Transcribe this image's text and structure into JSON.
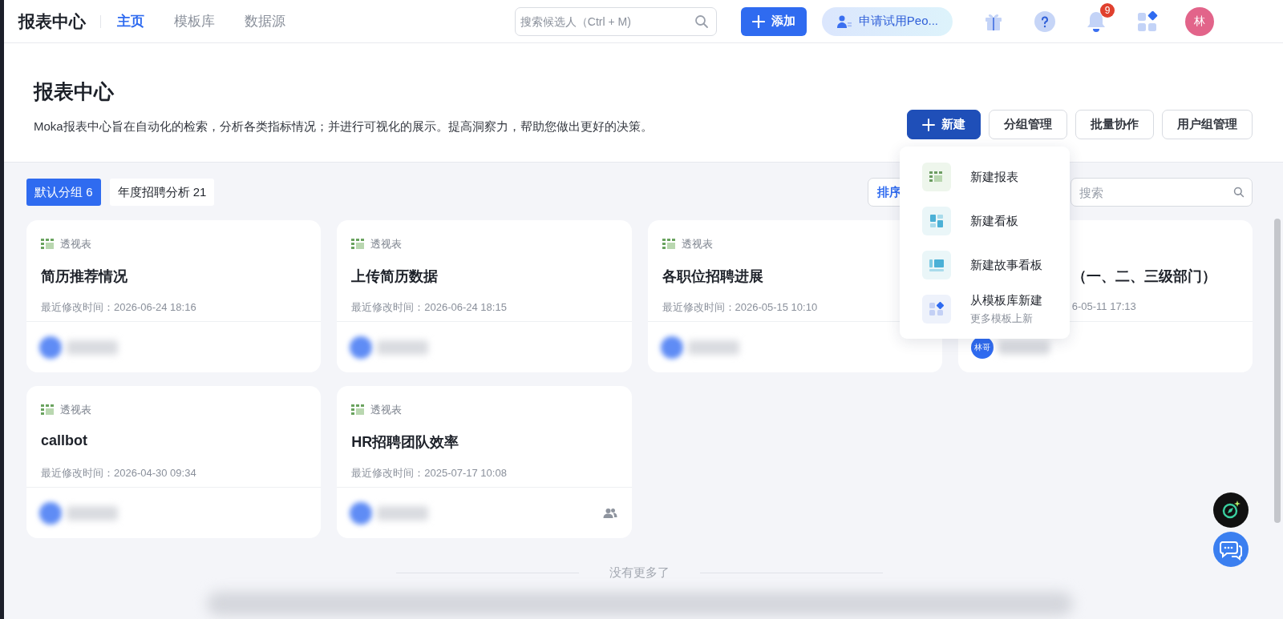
{
  "nav": {
    "logo": "报表中心",
    "tabs": [
      {
        "label": "主页",
        "selected": true
      },
      {
        "label": "模板库",
        "selected": false
      },
      {
        "label": "数据源",
        "selected": false
      }
    ],
    "search": {
      "placeholder": "搜索候选人（Ctrl + M)"
    },
    "add_button": "添加",
    "trial_button": "申请试用Peo...",
    "notification_count": "9",
    "avatar": "林"
  },
  "header": {
    "title": "报表中心",
    "description": "Moka报表中心旨在自动化的检索，分析各类指标情况；并进行可视化的展示。提高洞察力，帮助您做出更好的决策。",
    "buttons": [
      {
        "label": "新建",
        "kind": "primary"
      },
      {
        "label": "分组管理",
        "kind": "default"
      },
      {
        "label": "批量协作",
        "kind": "default"
      },
      {
        "label": "用户组管理",
        "kind": "default"
      }
    ]
  },
  "groups": [
    {
      "label": "默认分组 6",
      "selected": true
    },
    {
      "label": "年度招聘分析 21",
      "selected": false
    }
  ],
  "toolbar": {
    "sort_button": "排序",
    "search": {
      "placeholder": "搜索"
    }
  },
  "cards": [
    {
      "type": "透视表",
      "title": "简历推荐情况",
      "modified": "最近修改时间：2026-06-24 18:16",
      "shared": false
    },
    {
      "type": "透视表",
      "title": "上传简历数据",
      "modified": "最近修改时间：2026-06-24 18:15",
      "shared": false
    },
    {
      "type": "透视表",
      "title": "各职位招聘进展",
      "modified": "最近修改时间：2026-05-15 10:10",
      "shared": false
    },
    {
      "title": "（一、二、三级部门）",
      "modified": "6-05-11 17:13",
      "owner_initials": "林哥",
      "shared": false,
      "partly_hidden": true
    },
    {
      "type": "透视表",
      "title": "callbot",
      "modified": "最近修改时间：2026-04-30 09:34",
      "shared": false
    },
    {
      "type": "透视表",
      "title": "HR招聘团队效率",
      "modified": "最近修改时间：2025-07-17 10:08",
      "shared": true
    }
  ],
  "footer": "没有更多了",
  "new_menu": {
    "items": [
      {
        "label": "新建报表",
        "kind": "report"
      },
      {
        "label": "新建看板",
        "kind": "dashboard"
      },
      {
        "label": "新建故事看板",
        "kind": "story"
      },
      {
        "label": "从模板库新建",
        "sublabel": "更多模板上新",
        "kind": "template"
      }
    ]
  }
}
